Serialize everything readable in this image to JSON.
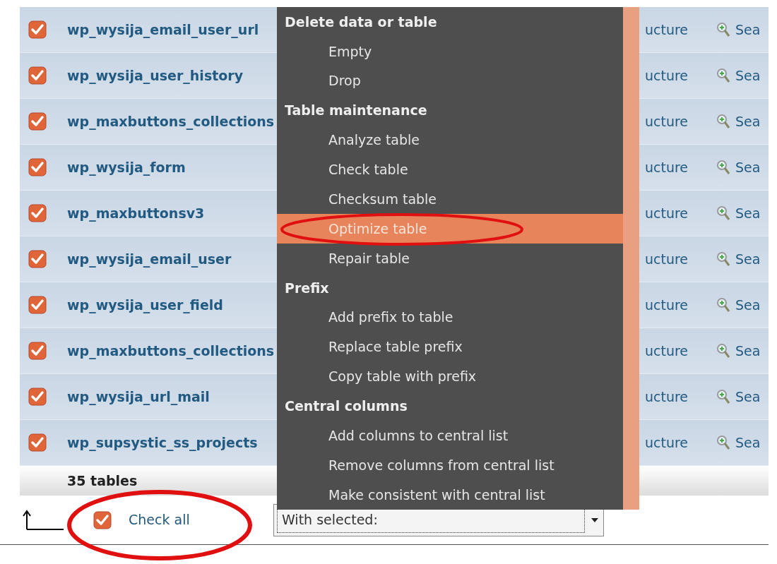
{
  "tables": [
    {
      "name": "wp_wysija_email_user_url",
      "checked": true,
      "actions": [
        "ucture",
        "Sea"
      ]
    },
    {
      "name": "wp_wysija_user_history",
      "checked": true,
      "actions": [
        "ucture",
        "Sea"
      ]
    },
    {
      "name": "wp_maxbuttons_collections",
      "checked": true,
      "actions": [
        "ucture",
        "Sea"
      ]
    },
    {
      "name": "wp_wysija_form",
      "checked": true,
      "actions": [
        "ucture",
        "Sea"
      ]
    },
    {
      "name": "wp_maxbuttonsv3",
      "checked": true,
      "actions": [
        "ucture",
        "Sea"
      ]
    },
    {
      "name": "wp_wysija_email_user",
      "checked": true,
      "actions": [
        "ucture",
        "Sea"
      ]
    },
    {
      "name": "wp_wysija_user_field",
      "checked": true,
      "actions": [
        "ucture",
        "Sea"
      ]
    },
    {
      "name": "wp_maxbuttons_collections",
      "checked": true,
      "actions": [
        "ucture",
        "Sea"
      ]
    },
    {
      "name": "wp_wysija_url_mail",
      "checked": true,
      "actions": [
        "ucture",
        "Sea"
      ]
    },
    {
      "name": "wp_supsystic_ss_projects",
      "checked": true,
      "actions": [
        "ucture",
        "Sea"
      ]
    }
  ],
  "footer": {
    "count": "35 tables"
  },
  "check_all": {
    "label": "Check all",
    "checked": true
  },
  "with_selected": {
    "value": "With selected:"
  },
  "menu": [
    {
      "kind": "header",
      "label": "Delete data or table"
    },
    {
      "kind": "item",
      "label": "Empty",
      "selected": false
    },
    {
      "kind": "item",
      "label": "Drop",
      "selected": false
    },
    {
      "kind": "header",
      "label": "Table maintenance"
    },
    {
      "kind": "item",
      "label": "Analyze table",
      "selected": false
    },
    {
      "kind": "item",
      "label": "Check table",
      "selected": false
    },
    {
      "kind": "item",
      "label": "Checksum table",
      "selected": false
    },
    {
      "kind": "item",
      "label": "Optimize table",
      "selected": true
    },
    {
      "kind": "item",
      "label": "Repair table",
      "selected": false
    },
    {
      "kind": "header",
      "label": "Prefix"
    },
    {
      "kind": "item",
      "label": "Add prefix to table",
      "selected": false
    },
    {
      "kind": "item",
      "label": "Replace table prefix",
      "selected": false
    },
    {
      "kind": "item",
      "label": "Copy table with prefix",
      "selected": false
    },
    {
      "kind": "header",
      "label": "Central columns"
    },
    {
      "kind": "item",
      "label": "Add columns to central list",
      "selected": false
    },
    {
      "kind": "item",
      "label": "Remove columns from central list",
      "selected": false
    },
    {
      "kind": "item",
      "label": "Make consistent with central list",
      "selected": false
    }
  ]
}
